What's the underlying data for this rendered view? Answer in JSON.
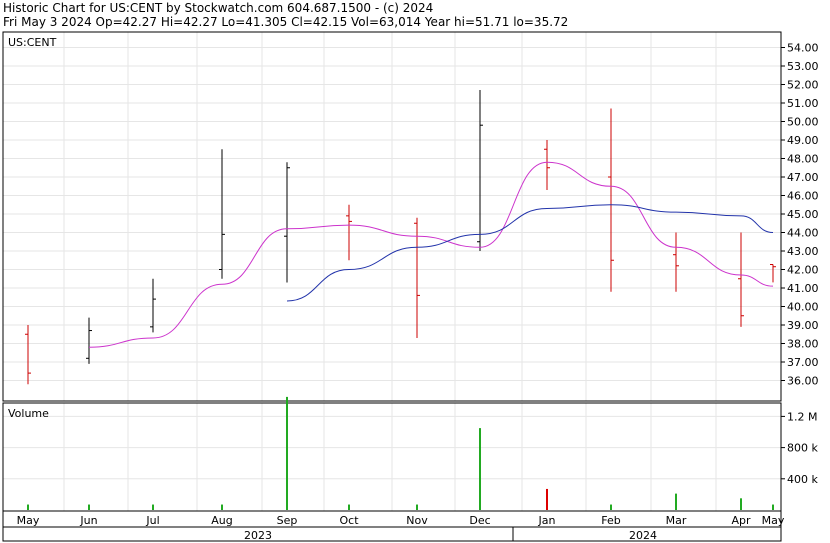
{
  "header": {
    "line1": "Historic Chart for US:CENT by Stockwatch.com 604.687.1500 - (c) 2024",
    "line2": "Fri May  3 2024  Op=42.27  Hi=42.27  Lo=41.305  Cl=42.15  Vol=63,014  Year hi=51.71  lo=35.72"
  },
  "colors": {
    "candle_up": "#000000",
    "candle_down": "#cc0000",
    "ma_short": "#cc33cc",
    "ma_long": "#2233aa",
    "volume_up": "#22aa22",
    "volume_down": "#dd0000",
    "grid": "#e6e6e6",
    "frame": "#000000"
  },
  "chart_data": [
    {
      "type": "line",
      "subtype": "candlestick",
      "symbol_label": "US:CENT",
      "ylim": [
        35,
        54.5
      ],
      "y_ticks": [
        "54.00",
        "53.00",
        "52.00",
        "51.00",
        "50.00",
        "49.00",
        "48.00",
        "47.00",
        "46.00",
        "45.00",
        "44.00",
        "43.00",
        "42.00",
        "41.00",
        "40.00",
        "39.00",
        "38.00",
        "37.00",
        "36.00"
      ],
      "x_ticks": [
        "May",
        "Jun",
        "Jul",
        "Aug",
        "Sep",
        "Oct",
        "Nov",
        "Dec",
        "Jan",
        "Feb",
        "Mar",
        "Apr",
        "May"
      ],
      "year_labels": [
        "2023",
        "2024"
      ],
      "grid": true,
      "ohlc_months": [
        "May",
        "Jun",
        "Jul",
        "Aug",
        "Sep",
        "Oct",
        "Nov",
        "Dec",
        "Jan",
        "Feb",
        "Mar",
        "Apr",
        "May"
      ],
      "ohlc": [
        {
          "open": 38.5,
          "high": 39.0,
          "low": 35.8,
          "close": 36.4
        },
        {
          "open": 37.2,
          "high": 39.4,
          "low": 36.9,
          "close": 38.7
        },
        {
          "open": 38.9,
          "high": 41.5,
          "low": 38.6,
          "close": 40.4
        },
        {
          "open": 42.0,
          "high": 48.5,
          "low": 41.5,
          "close": 43.9
        },
        {
          "open": 43.8,
          "high": 47.8,
          "low": 41.3,
          "close": 47.5
        },
        {
          "open": 44.9,
          "high": 45.5,
          "low": 42.5,
          "close": 44.6
        },
        {
          "open": 44.5,
          "high": 44.8,
          "low": 38.3,
          "close": 40.6
        },
        {
          "open": 43.5,
          "high": 51.7,
          "low": 43.0,
          "close": 49.8
        },
        {
          "open": 48.5,
          "high": 49.0,
          "low": 46.3,
          "close": 47.5
        },
        {
          "open": 47.0,
          "high": 50.7,
          "low": 40.8,
          "close": 42.5
        },
        {
          "open": 42.8,
          "high": 44.0,
          "low": 40.8,
          "close": 42.2
        },
        {
          "open": 41.5,
          "high": 44.0,
          "low": 38.9,
          "close": 39.5
        },
        {
          "open": 42.27,
          "high": 42.27,
          "low": 41.305,
          "close": 42.15
        }
      ],
      "moving_averages": [
        {
          "name": "",
          "color": "#cc33cc",
          "values": [
            {
              "x": "Jun 2023",
              "y": 37.8
            },
            {
              "x": "Jul 2023",
              "y": 38.3
            },
            {
              "x": "Aug 2023",
              "y": 41.2
            },
            {
              "x": "Sep 2023",
              "y": 44.2
            },
            {
              "x": "Oct 2023",
              "y": 44.4
            },
            {
              "x": "Nov 2023",
              "y": 43.8
            },
            {
              "x": "Dec 2023",
              "y": 43.2
            },
            {
              "x": "Jan 2024",
              "y": 47.8
            },
            {
              "x": "Feb 2024",
              "y": 46.5
            },
            {
              "x": "Mar 2024",
              "y": 43.2
            },
            {
              "x": "Apr 2024",
              "y": 41.7
            },
            {
              "x": "May 2024",
              "y": 41.1
            }
          ]
        },
        {
          "name": "",
          "color": "#2233aa",
          "values": [
            {
              "x": "Sep 2023",
              "y": 40.3
            },
            {
              "x": "Oct 2023",
              "y": 42.0
            },
            {
              "x": "Nov 2023",
              "y": 43.2
            },
            {
              "x": "Dec 2023",
              "y": 43.9
            },
            {
              "x": "Jan 2024",
              "y": 45.3
            },
            {
              "x": "Feb 2024",
              "y": 45.5
            },
            {
              "x": "Mar 2024",
              "y": 45.1
            },
            {
              "x": "Apr 2024",
              "y": 44.9
            },
            {
              "x": "May 2024",
              "y": 44.0
            }
          ]
        }
      ]
    },
    {
      "type": "bar",
      "title": "Volume",
      "y_ticks": [
        "1.2 M",
        "800 k",
        "400 k"
      ],
      "ylim": [
        0,
        1500000
      ],
      "spikes": [
        {
          "x": "Sep 2023",
          "value": 1450000,
          "direction": "up"
        },
        {
          "x": "Dec 2023",
          "value": 1050000,
          "direction": "up"
        },
        {
          "x": "Jan 2024",
          "value": 270000,
          "direction": "down"
        },
        {
          "x": "Mar 2024",
          "value": 210000,
          "direction": "up"
        },
        {
          "x": "Apr 2024",
          "value": 150000,
          "direction": "up"
        }
      ],
      "typical_daily_volume": 70000
    }
  ]
}
